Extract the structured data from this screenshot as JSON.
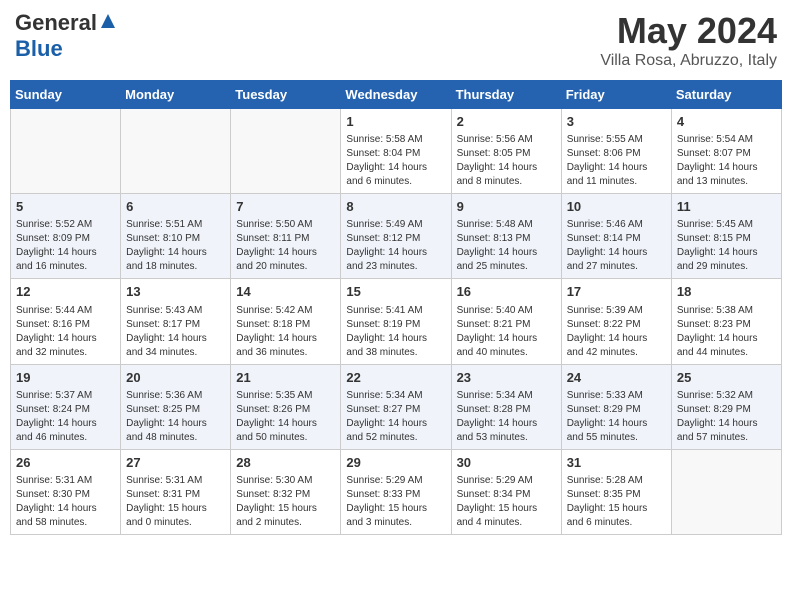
{
  "header": {
    "logo_general": "General",
    "logo_blue": "Blue",
    "month": "May 2024",
    "location": "Villa Rosa, Abruzzo, Italy"
  },
  "days_of_week": [
    "Sunday",
    "Monday",
    "Tuesday",
    "Wednesday",
    "Thursday",
    "Friday",
    "Saturday"
  ],
  "weeks": [
    [
      {
        "day": "",
        "info": ""
      },
      {
        "day": "",
        "info": ""
      },
      {
        "day": "",
        "info": ""
      },
      {
        "day": "1",
        "info": "Sunrise: 5:58 AM\nSunset: 8:04 PM\nDaylight: 14 hours\nand 6 minutes."
      },
      {
        "day": "2",
        "info": "Sunrise: 5:56 AM\nSunset: 8:05 PM\nDaylight: 14 hours\nand 8 minutes."
      },
      {
        "day": "3",
        "info": "Sunrise: 5:55 AM\nSunset: 8:06 PM\nDaylight: 14 hours\nand 11 minutes."
      },
      {
        "day": "4",
        "info": "Sunrise: 5:54 AM\nSunset: 8:07 PM\nDaylight: 14 hours\nand 13 minutes."
      }
    ],
    [
      {
        "day": "5",
        "info": "Sunrise: 5:52 AM\nSunset: 8:09 PM\nDaylight: 14 hours\nand 16 minutes."
      },
      {
        "day": "6",
        "info": "Sunrise: 5:51 AM\nSunset: 8:10 PM\nDaylight: 14 hours\nand 18 minutes."
      },
      {
        "day": "7",
        "info": "Sunrise: 5:50 AM\nSunset: 8:11 PM\nDaylight: 14 hours\nand 20 minutes."
      },
      {
        "day": "8",
        "info": "Sunrise: 5:49 AM\nSunset: 8:12 PM\nDaylight: 14 hours\nand 23 minutes."
      },
      {
        "day": "9",
        "info": "Sunrise: 5:48 AM\nSunset: 8:13 PM\nDaylight: 14 hours\nand 25 minutes."
      },
      {
        "day": "10",
        "info": "Sunrise: 5:46 AM\nSunset: 8:14 PM\nDaylight: 14 hours\nand 27 minutes."
      },
      {
        "day": "11",
        "info": "Sunrise: 5:45 AM\nSunset: 8:15 PM\nDaylight: 14 hours\nand 29 minutes."
      }
    ],
    [
      {
        "day": "12",
        "info": "Sunrise: 5:44 AM\nSunset: 8:16 PM\nDaylight: 14 hours\nand 32 minutes."
      },
      {
        "day": "13",
        "info": "Sunrise: 5:43 AM\nSunset: 8:17 PM\nDaylight: 14 hours\nand 34 minutes."
      },
      {
        "day": "14",
        "info": "Sunrise: 5:42 AM\nSunset: 8:18 PM\nDaylight: 14 hours\nand 36 minutes."
      },
      {
        "day": "15",
        "info": "Sunrise: 5:41 AM\nSunset: 8:19 PM\nDaylight: 14 hours\nand 38 minutes."
      },
      {
        "day": "16",
        "info": "Sunrise: 5:40 AM\nSunset: 8:21 PM\nDaylight: 14 hours\nand 40 minutes."
      },
      {
        "day": "17",
        "info": "Sunrise: 5:39 AM\nSunset: 8:22 PM\nDaylight: 14 hours\nand 42 minutes."
      },
      {
        "day": "18",
        "info": "Sunrise: 5:38 AM\nSunset: 8:23 PM\nDaylight: 14 hours\nand 44 minutes."
      }
    ],
    [
      {
        "day": "19",
        "info": "Sunrise: 5:37 AM\nSunset: 8:24 PM\nDaylight: 14 hours\nand 46 minutes."
      },
      {
        "day": "20",
        "info": "Sunrise: 5:36 AM\nSunset: 8:25 PM\nDaylight: 14 hours\nand 48 minutes."
      },
      {
        "day": "21",
        "info": "Sunrise: 5:35 AM\nSunset: 8:26 PM\nDaylight: 14 hours\nand 50 minutes."
      },
      {
        "day": "22",
        "info": "Sunrise: 5:34 AM\nSunset: 8:27 PM\nDaylight: 14 hours\nand 52 minutes."
      },
      {
        "day": "23",
        "info": "Sunrise: 5:34 AM\nSunset: 8:28 PM\nDaylight: 14 hours\nand 53 minutes."
      },
      {
        "day": "24",
        "info": "Sunrise: 5:33 AM\nSunset: 8:29 PM\nDaylight: 14 hours\nand 55 minutes."
      },
      {
        "day": "25",
        "info": "Sunrise: 5:32 AM\nSunset: 8:29 PM\nDaylight: 14 hours\nand 57 minutes."
      }
    ],
    [
      {
        "day": "26",
        "info": "Sunrise: 5:31 AM\nSunset: 8:30 PM\nDaylight: 14 hours\nand 58 minutes."
      },
      {
        "day": "27",
        "info": "Sunrise: 5:31 AM\nSunset: 8:31 PM\nDaylight: 15 hours\nand 0 minutes."
      },
      {
        "day": "28",
        "info": "Sunrise: 5:30 AM\nSunset: 8:32 PM\nDaylight: 15 hours\nand 2 minutes."
      },
      {
        "day": "29",
        "info": "Sunrise: 5:29 AM\nSunset: 8:33 PM\nDaylight: 15 hours\nand 3 minutes."
      },
      {
        "day": "30",
        "info": "Sunrise: 5:29 AM\nSunset: 8:34 PM\nDaylight: 15 hours\nand 4 minutes."
      },
      {
        "day": "31",
        "info": "Sunrise: 5:28 AM\nSunset: 8:35 PM\nDaylight: 15 hours\nand 6 minutes."
      },
      {
        "day": "",
        "info": ""
      }
    ]
  ]
}
